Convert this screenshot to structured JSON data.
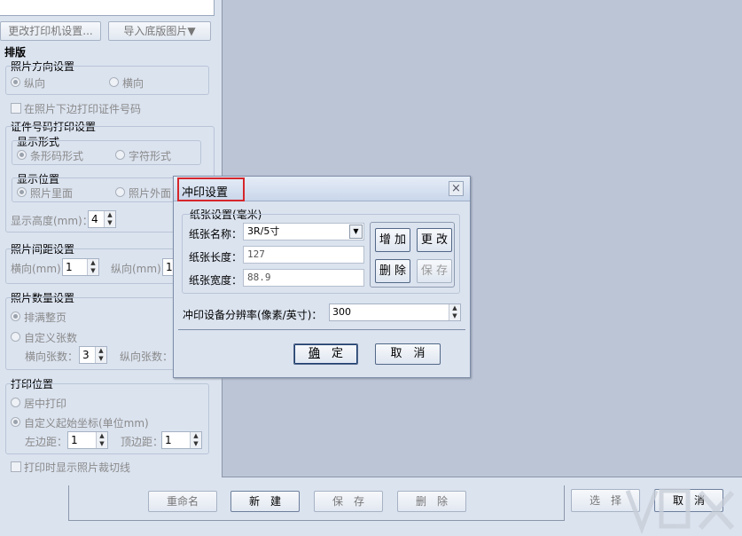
{
  "left": {
    "change_printer_btn": "更改打印机设置...",
    "import_bg_btn": "导入底版图片▼",
    "layout_heading": "排版",
    "photo_orientation": {
      "title": "照片方向设置",
      "portrait": "纵向",
      "landscape": "横向"
    },
    "print_id_below": "在照片下边打印证件号码",
    "id_print": {
      "title": "证件号码打印设置",
      "display_form": "显示形式",
      "barcode": "条形码形式",
      "character": "字符形式",
      "display_pos": "显示位置",
      "inside": "照片里面",
      "outside": "照片外面",
      "height_label": "显示高度(mm)：",
      "height_value": "4"
    },
    "spacing": {
      "title": "照片间距设置",
      "h_label": "横向(mm)：",
      "h_value": "1",
      "v_label": "纵向(mm)：",
      "v_value": "1"
    },
    "count": {
      "title": "照片数量设置",
      "fill_page": "排满整页",
      "custom": "自定义张数",
      "h_count_label": "横向张数：",
      "h_count_value": "3",
      "v_count_label": "纵向张数："
    },
    "position": {
      "title": "打印位置",
      "center": "居中打印",
      "custom_origin": "自定义起始坐标(单位mm)",
      "left_margin_label": "左边距：",
      "left_margin_value": "1",
      "top_margin_label": "顶边距：",
      "top_margin_value": "1"
    },
    "show_cut_lines": "打印时显示照片裁切线"
  },
  "bottom": {
    "rename": "重命名",
    "new": "新　建",
    "save": "保　存",
    "delete": "删　除",
    "select": "选　择",
    "cancel": "取　消"
  },
  "dialog": {
    "title": "冲印设置",
    "close": "×",
    "paper_group": "纸张设置(毫米)",
    "paper_name_label": "纸张名称：",
    "paper_name_value": "3R/5寸",
    "paper_length_label": "纸张长度：",
    "paper_length_value": "127",
    "paper_width_label": "纸张宽度：",
    "paper_width_value": "88.9",
    "add": "增 加",
    "modify": "更 改",
    "remove": "删 除",
    "save": "保 存",
    "dpi_label": "冲印设备分辨率(像素/英寸)：",
    "dpi_value": "300",
    "ok_prefix": "确",
    "ok_suffix": "　定",
    "cancel": "取　消"
  },
  "colors": {
    "highlight": "#d6262b",
    "preview_bg": "#bcc5d6",
    "panel_bg": "#dbe3ef"
  }
}
